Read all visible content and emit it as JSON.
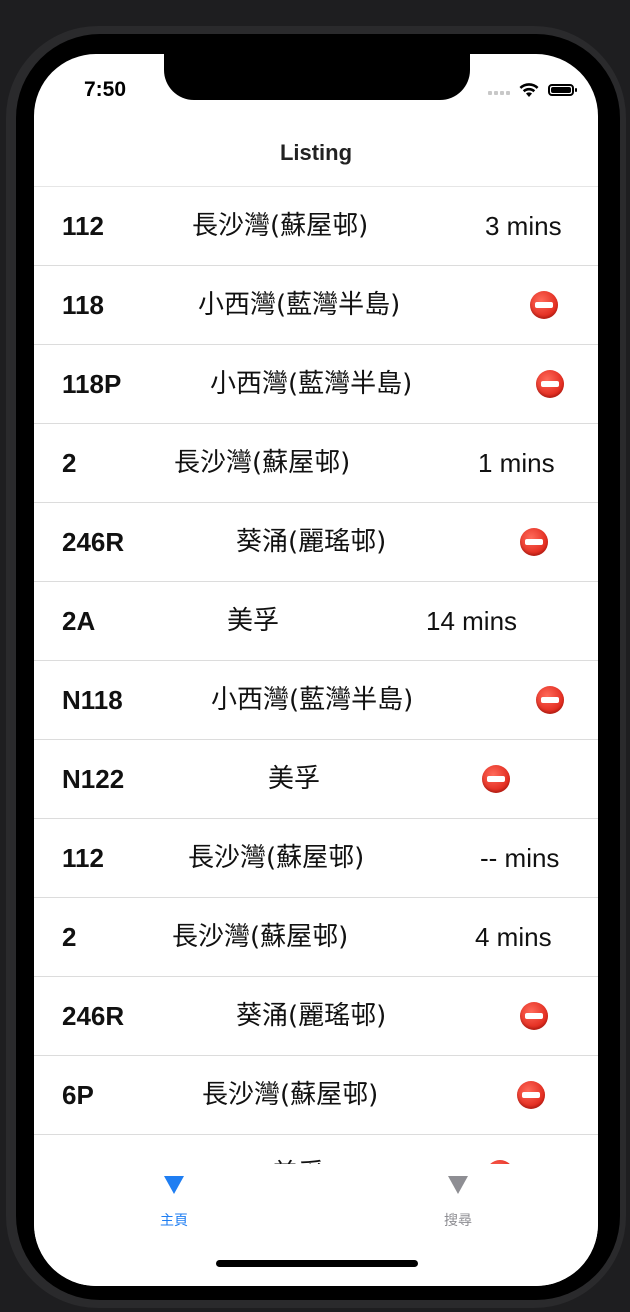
{
  "status_bar": {
    "time": "7:50"
  },
  "nav": {
    "title": "Listing"
  },
  "list": {
    "rows": [
      {
        "route": "112",
        "destination": "長沙灣(蘇屋邨)",
        "eta": "3 mins",
        "unavailable": false
      },
      {
        "route": "118",
        "destination": "小西灣(藍灣半島)",
        "eta": "",
        "unavailable": true
      },
      {
        "route": "118P",
        "destination": "小西灣(藍灣半島)",
        "eta": "",
        "unavailable": true
      },
      {
        "route": "2",
        "destination": "長沙灣(蘇屋邨)",
        "eta": "1 mins",
        "unavailable": false
      },
      {
        "route": "246R",
        "destination": "葵涌(麗瑤邨)",
        "eta": "",
        "unavailable": true
      },
      {
        "route": "2A",
        "destination": "美孚",
        "eta": "14 mins",
        "unavailable": false
      },
      {
        "route": "N118",
        "destination": "小西灣(藍灣半島)",
        "eta": "",
        "unavailable": true
      },
      {
        "route": "N122",
        "destination": "美孚",
        "eta": "",
        "unavailable": true
      },
      {
        "route": "112",
        "destination": "長沙灣(蘇屋邨)",
        "eta": "-- mins",
        "unavailable": false
      },
      {
        "route": "2",
        "destination": "長沙灣(蘇屋邨)",
        "eta": "4 mins",
        "unavailable": false
      },
      {
        "route": "246R",
        "destination": "葵涌(麗瑤邨)",
        "eta": "",
        "unavailable": true
      },
      {
        "route": "6P",
        "destination": "長沙灣(蘇屋邨)",
        "eta": "",
        "unavailable": true
      },
      {
        "route": "",
        "destination": "美孚",
        "eta": "",
        "unavailable": true
      }
    ],
    "unavailable_icon": "no-entry-icon"
  },
  "tabbar": {
    "tabs": [
      {
        "label": "主頁",
        "icon": "triangle-down-icon",
        "active": true
      },
      {
        "label": "搜尋",
        "icon": "triangle-down-icon",
        "active": false
      }
    ]
  },
  "colors": {
    "accent": "#1f7ef2",
    "inactive": "#8e8e93",
    "no_entry": "#e0281c"
  }
}
